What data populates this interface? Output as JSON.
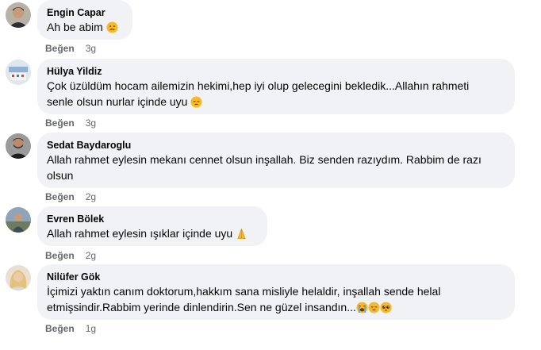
{
  "comments": [
    {
      "author": "Engin Capar",
      "text": "Ah be abim",
      "emojis": [
        "frowning-face-emoji"
      ],
      "like_label": "Beğen",
      "time": "3g"
    },
    {
      "author": "Hülya Yildiz",
      "text_line1": "Çok üzüldüm hocam ailemizin hekimi,hep iyi olup gelecegini bekledik...Allahın rahmeti",
      "text_line2": "senle olsun nurlar içinde uyu",
      "emojis": [
        "pensive-face-emoji"
      ],
      "like_label": "Beğen",
      "time": "3g"
    },
    {
      "author": "Sedat Baydaroglu",
      "text_line1": "Allah rahmet eylesin mekanı cennet olsun inşallah. Biz senden razıydım. Rabbim de razı",
      "text_line2": "olsun",
      "like_label": "Beğen",
      "time": "2g"
    },
    {
      "author": "Evren Bölek",
      "text": "Allah rahmet eylesin ışıklar içinde uyu",
      "emojis": [
        "folded-hands-emoji"
      ],
      "like_label": "Beğen",
      "time": "2g"
    },
    {
      "author": "Nilüfer Gök",
      "text_line1": "İçimizi yaktın canım doktorum,hakkım sana misliyle helaldir, inşallah sende helal",
      "text_line2": "etmişsindir.Rabbim yerinde dinlendirin.Sen ne güzel insandın...",
      "emojis": [
        "loudly-crying-face-emoji",
        "pensive-face-emoji",
        "pleading-face-emoji"
      ],
      "like_label": "Beğen",
      "time": "1g"
    }
  ],
  "colors": {
    "bubble_bg": "#f0f2f5",
    "meta_text": "#65676b",
    "emoji_yellow": "#f7b928"
  }
}
